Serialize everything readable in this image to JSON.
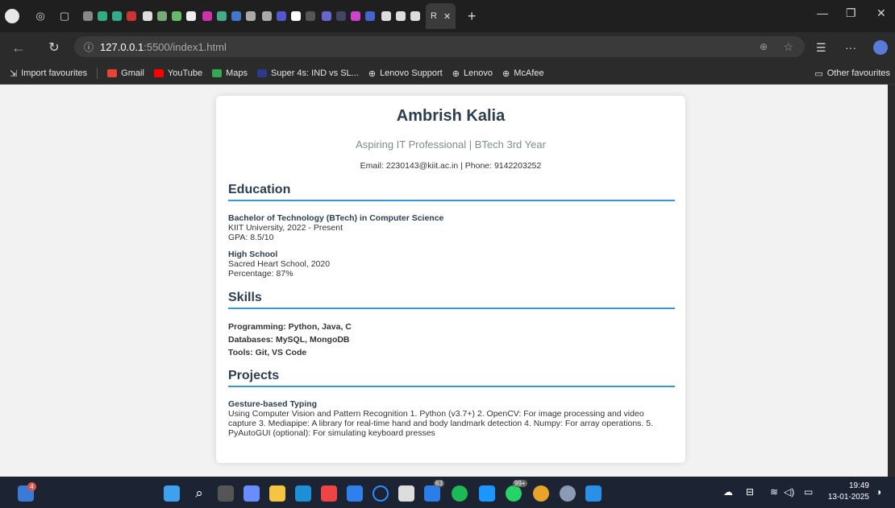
{
  "browser": {
    "active_tab_label": "R",
    "url_host": "127.0.0.1",
    "url_port_path": ":5500/index1.html",
    "bookmarks": [
      {
        "label": "Import favourites"
      },
      {
        "label": "Gmail"
      },
      {
        "label": "YouTube"
      },
      {
        "label": "Maps"
      },
      {
        "label": "Super 4s: IND vs SL..."
      },
      {
        "label": "Lenovo Support"
      },
      {
        "label": "Lenovo"
      },
      {
        "label": "McAfee"
      }
    ],
    "other_favourites": "Other favourites"
  },
  "resume": {
    "name": "Ambrish Kalia",
    "subtitle": "Aspiring IT Professional | BTech 3rd Year",
    "contact": "Email: 2230143@kiit.ac.in | Phone: 9142203252",
    "education_heading": "Education",
    "edu1_title": "Bachelor of Technology (BTech) in Computer Science",
    "edu1_line1": "KIIT University, 2022 - Present",
    "edu1_line2": "GPA: 8.5/10",
    "edu2_title": "High School",
    "edu2_line1": "Sacred Heart School, 2020",
    "edu2_line2": "Percentage: 87%",
    "skills_heading": "Skills",
    "skill1": "Programming: Python, Java, C",
    "skill2": "Databases: MySQL, MongoDB",
    "skill3": "Tools: Git, VS Code",
    "projects_heading": "Projects",
    "proj_title": "Gesture-based Typing",
    "proj_desc": "Using Computer Vision and Pattern Recognition 1. Python (v3.7+) 2. OpenCV: For image processing and video capture 3. Mediapipe: A library for real-time hand and body landmark detection 4. Numpy: For array operations. 5. PyAutoGUI (optional): For simulating keyboard presses"
  },
  "taskbar": {
    "time": "19:49",
    "date": "13-01-2025",
    "widget_badge": "4",
    "badge_63": "63",
    "badge_99": "99+"
  }
}
